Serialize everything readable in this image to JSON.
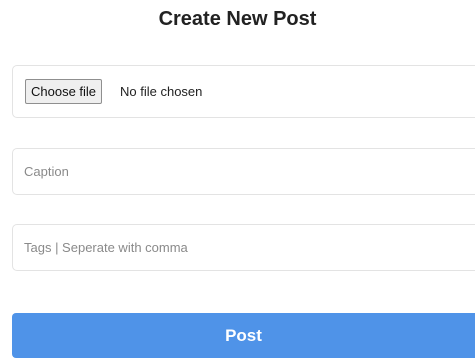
{
  "form": {
    "title": "Create New Post",
    "file": {
      "button_label": "Choose file",
      "status": "No file chosen"
    },
    "caption": {
      "value": "",
      "placeholder": "Caption"
    },
    "tags": {
      "value": "",
      "placeholder": "Tags | Seperate with comma"
    },
    "submit_label": "Post"
  },
  "colors": {
    "accent": "#4f93e8",
    "field_border": "#e3e3e3",
    "title_text": "#222222"
  }
}
